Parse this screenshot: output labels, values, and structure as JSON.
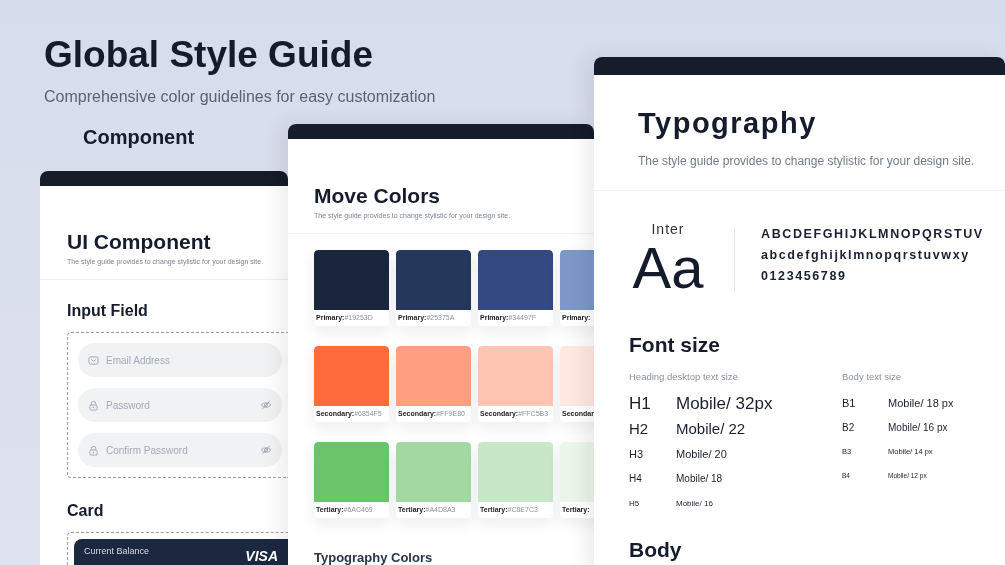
{
  "header": {
    "title": "Global Style Guide",
    "subtitle": "Comprehensive color guidelines for easy customization",
    "section_label": "Component"
  },
  "component_panel": {
    "title": "UI Component",
    "description": "The style guide provides to change stylistic for your design site.",
    "input_section": "Input Field",
    "inputs": [
      {
        "placeholder": "Email Address",
        "kind": "email"
      },
      {
        "placeholder": "Password",
        "kind": "password"
      },
      {
        "placeholder": "Confirm Password",
        "kind": "password"
      }
    ],
    "card_section": "Card",
    "card": {
      "label": "Current Balance",
      "brand": "VISA"
    }
  },
  "colors_panel": {
    "title": "Move Colors",
    "description": "The style guide provides to change stylistic for your design site.",
    "rows": [
      {
        "swatches": [
          {
            "label": "Primary:",
            "code": "#19253D",
            "color": "#1b253d"
          },
          {
            "label": "Primary:",
            "code": "#25375A",
            "color": "#25375a"
          },
          {
            "label": "Primary:",
            "code": "#34497F",
            "color": "#34497f"
          },
          {
            "label": "Primary:",
            "color": "#7d97c8"
          }
        ]
      },
      {
        "swatches": [
          {
            "label": "Secondary:",
            "code": "#6854F5",
            "color": "#ff6b3d"
          },
          {
            "label": "Secondary:",
            "code": "#FF9E80",
            "color": "#ff9e80"
          },
          {
            "label": "Secondary:",
            "code": "#FFC5B3",
            "color": "#ffc5b3"
          },
          {
            "label": "Secondar",
            "color": "#ffe8e0"
          }
        ]
      },
      {
        "swatches": [
          {
            "label": "Tertiary:",
            "code": "#6AC469",
            "color": "#6ac469"
          },
          {
            "label": "Tertiary:",
            "code": "#A4D8A3",
            "color": "#a4d8a3"
          },
          {
            "label": "Tertiary:",
            "code": "#C8E7C3",
            "color": "#c8e7c7"
          },
          {
            "label": "Tertiary:",
            "color": "#ebf6ea"
          }
        ]
      }
    ],
    "typography_title": "Typography Colors"
  },
  "typography_panel": {
    "title": "Typography",
    "description": "The style guide provides to change stylistic for your design site.",
    "font_name": "Inter",
    "sample": "Aa",
    "glyph_lines": [
      "ABCDEFGHIJKLMNOPQRSTUV",
      "abcdefghijklmnopqrstuvwxy",
      "0123456789"
    ],
    "font_size_title": "Font size",
    "heading_label": "Heading desktop text size",
    "headings": [
      {
        "tag": "H1",
        "size": "Mobile/ 32px"
      },
      {
        "tag": "H2",
        "size": "Mobile/ 22"
      },
      {
        "tag": "H3",
        "size": "Mobile/ 20"
      },
      {
        "tag": "H4",
        "size": "Mobile/ 18"
      },
      {
        "tag": "H5",
        "size": "Mobile/ 16"
      }
    ],
    "body_label": "Body text size",
    "body_sizes": [
      {
        "tag": "B1",
        "size": "Mobile/ 18 px"
      },
      {
        "tag": "B2",
        "size": "Mobile/ 16 px"
      },
      {
        "tag": "B3",
        "size": "Mobile/ 14 px"
      },
      {
        "tag": "B4",
        "size": "Mobile/ 12 px"
      }
    ],
    "next_section": "Body"
  }
}
